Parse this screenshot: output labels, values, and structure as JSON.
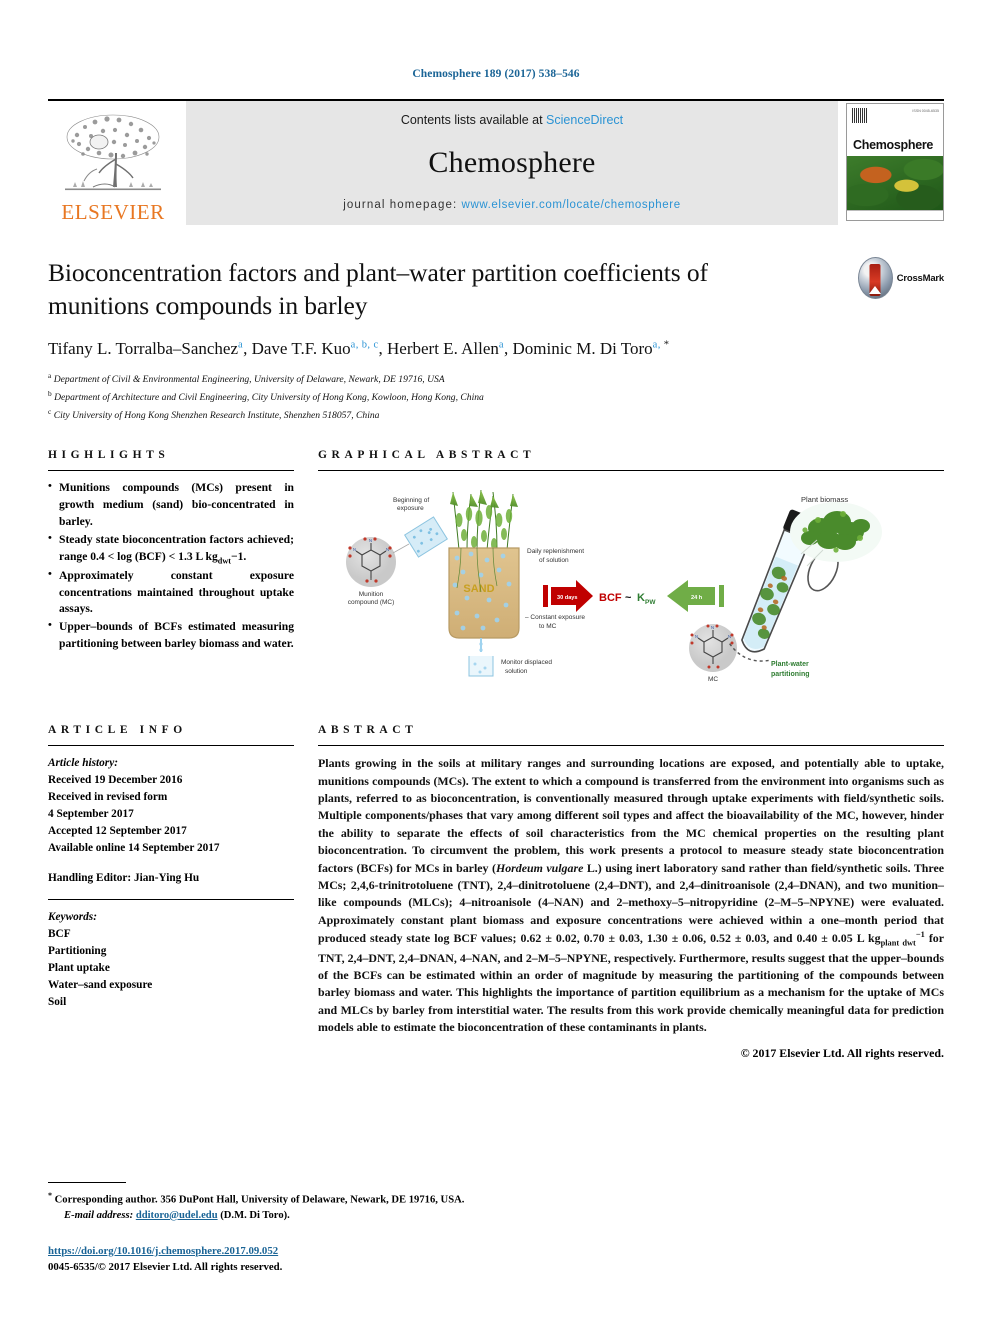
{
  "running_head": "Chemosphere 189 (2017) 538–546",
  "masthead": {
    "publisher_name": "ELSEVIER",
    "contents_prefix": "Contents lists available at ",
    "contents_link": "ScienceDirect",
    "journal_name": "Chemosphere",
    "homepage_prefix": "journal homepage: ",
    "homepage_url": "www.elsevier.com/locate/chemosphere",
    "cover_title": "Chemosphere",
    "cover_issn": "ISSN 0045-6535"
  },
  "article": {
    "title": "Bioconcentration factors and plant–water partition coefficients of munitions compounds in barley",
    "crossmark_label": "CrossMark",
    "authors": [
      {
        "name": "Tifany L. Torralba–Sanchez",
        "marks": "a",
        "sep": ", "
      },
      {
        "name": "Dave T.F. Kuo",
        "marks": "a, b, c",
        "sep": ", "
      },
      {
        "name": "Herbert E. Allen",
        "marks": "a",
        "sep": ", "
      },
      {
        "name": "Dominic M. Di Toro",
        "marks": "a, ",
        "star": "*",
        "sep": ""
      }
    ],
    "affiliations": [
      {
        "mark": "a",
        "text": "Department of Civil & Environmental Engineering, University of Delaware, Newark, DE 19716, USA"
      },
      {
        "mark": "b",
        "text": "Department of Architecture and Civil Engineering, City University of Hong Kong, Kowloon, Hong Kong, China"
      },
      {
        "mark": "c",
        "text": "City University of Hong Kong Shenzhen Research Institute, Shenzhen 518057, China"
      }
    ]
  },
  "highlights": {
    "heading": "HIGHLIGHTS",
    "items": [
      "Munitions compounds (MCs) present in growth medium (sand) bio-concentrated in barley.",
      "Steady state bioconcentration factors achieved; range 0.4 < log (BCF) < 1.3 L kg",
      "Approximately constant exposure concentrations maintained throughout uptake assays.",
      "Upper–bounds of BCFs estimated measuring partitioning between barley biomass and water."
    ],
    "item2_sub": "dwt",
    "item2_tail": "−1."
  },
  "graphical_abstract": {
    "heading": "GRAPHICAL ABSTRACT",
    "labels": {
      "beginning_of_exposure": "Beginning of\nexposure",
      "munition_compound": "Munition\ncompound (MC)",
      "sand": "SAND",
      "daily_replenishment": "Daily replenishment\nof solution",
      "constant_exposure": "– Constant exposure\nto MC",
      "monitor_displaced": "Monitor displaced\nsolution",
      "red_arrow": "30 days",
      "center_equation": "BCF ~ K",
      "center_equation_sub": "PW",
      "green_arrow": "24 h",
      "plant_biomass": "Plant biomass",
      "mc": "MC",
      "plant_water_partitioning": "Plant-water\npartitioning"
    },
    "colors": {
      "red_arrow": "#c00000",
      "green_arrow": "#70ad47",
      "sand": "#d9b87c",
      "plant_green": "#4a8b2c",
      "water_blue": "#aaccee"
    }
  },
  "article_info": {
    "heading": "ARTICLE INFO",
    "history_label": "Article history:",
    "history": [
      "Received 19 December 2016",
      "Received in revised form",
      "4 September 2017",
      "Accepted 12 September 2017",
      "Available online 14 September 2017"
    ],
    "handling_editor": "Handling Editor: Jian-Ying Hu",
    "keywords_label": "Keywords:",
    "keywords": [
      "BCF",
      "Partitioning",
      "Plant uptake",
      "Water–sand exposure",
      "Soil"
    ]
  },
  "abstract": {
    "heading": "ABSTRACT",
    "p1": "Plants growing in the soils at military ranges and surrounding locations are exposed, and potentially able to uptake, munitions compounds (MCs). The extent to which a compound is transferred from the environment into organisms such as plants, referred to as bioconcentration, is conventionally measured through uptake experiments with field/synthetic soils. Multiple components/phases that vary among different soil types and affect the bioavailability of the MC, however, hinder the ability to separate the effects of soil characteristics from the MC chemical properties on the resulting plant bioconcentration. To circumvent the problem, this work presents a protocol to measure steady state bioconcentration factors (BCFs) for MCs in barley (",
    "italic1": "Hordeum vulgare",
    "p2": " L.) using inert laboratory sand rather than field/synthetic soils. Three MCs; 2,4,6-trinitrotoluene (TNT), 2,4–dinitrotoluene (2,4–DNT), and 2,4–dinitroanisole (2,4–DNAN), and two munition–like compounds (MLCs); 4–nitroanisole (4–NAN) and 2–methoxy–5–nitropyridine (2–M–5–NPYNE) were evaluated. Approximately constant plant biomass and exposure concentrations were achieved within a one–month period that produced steady state log BCF values; 0.62 ± 0.02, 0.70 ± 0.03, 1.30 ± 0.06, 0.52 ± 0.03, and 0.40 ± 0.05 L kg",
    "kg_sub": "plant dwt",
    "kg_sup": "−1",
    "p3": " for TNT, 2,4–DNT, 2,4–DNAN, 4–NAN, and 2–M–5–NPYNE, respectively. Furthermore, results suggest that the upper–bounds of the BCFs can be estimated within an order of magnitude by measuring the partitioning of the compounds between barley biomass and water. This highlights the importance of partition equilibrium as a mechanism for the uptake of MCs and MLCs by barley from interstitial water. The results from this work provide chemically meaningful data for prediction models able to estimate the bioconcentration of these contaminants in plants.",
    "copyright": "© 2017 Elsevier Ltd. All rights reserved."
  },
  "footer": {
    "corresponding_star": "*",
    "corresponding": " Corresponding author. 356 DuPont Hall, University of Delaware, Newark, DE 19716, USA.",
    "email_label": "E-mail address:",
    "email": "dditoro@udel.edu",
    "email_owner": " (D.M. Di Toro).",
    "doi": "https://doi.org/10.1016/j.chemosphere.2017.09.052",
    "issn_line": "0045-6535/© 2017 Elsevier Ltd. All rights reserved."
  }
}
